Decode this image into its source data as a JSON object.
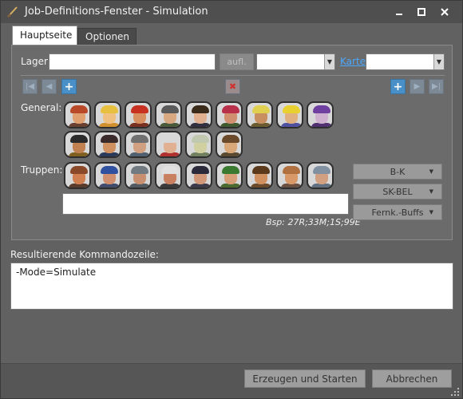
{
  "window": {
    "title": "Job-Definitions-Fenster - Simulation"
  },
  "tabs": [
    {
      "label": "Hauptseite",
      "active": true
    },
    {
      "label": "Optionen",
      "active": false
    }
  ],
  "main": {
    "lager_label": "Lager:",
    "lager_value": "",
    "aufl_button": "aufl.",
    "combo1_value": "",
    "karte_link": "Karte",
    "combo2_value": "",
    "general_label": "General:",
    "truppen_label": "Truppen:",
    "truppen_input_value": "",
    "hint": "Bsp: 27R;33M;1S;99E",
    "dropdown_buttons": [
      "B-K",
      "SK-BEL",
      "Fernk.-Buffs"
    ]
  },
  "result": {
    "label": "Resultierende Kommandozeile:",
    "value": "-Mode=Simulate"
  },
  "buttons": {
    "create": "Erzeugen und Starten",
    "cancel": "Abbrechen"
  },
  "colors": {
    "window_bg": "#616161",
    "panel_bg": "#6b6b6b",
    "accent_blue": "#4a90c8",
    "link": "#4aa8ff",
    "delete_red": "#d03030"
  },
  "generals": [
    {
      "name": "general-1",
      "hat": "#b84a2a",
      "face": "#e0a070",
      "body": "#6a4030"
    },
    {
      "name": "general-2",
      "hat": "#e8c040",
      "face": "#f0c080",
      "body": "#d09030"
    },
    {
      "name": "general-3",
      "hat": "#c83020",
      "face": "#d89060",
      "body": "#7a3020"
    },
    {
      "name": "general-4",
      "hat": "#5a5a5a",
      "face": "#d8a880",
      "body": "#4a5a3a"
    },
    {
      "name": "general-5",
      "hat": "#3a2a1a",
      "face": "#e0b090",
      "body": "#303040"
    },
    {
      "name": "general-6",
      "hat": "#b8304a",
      "face": "#d09070",
      "body": "#405a30"
    },
    {
      "name": "general-7",
      "hat": "#e0d050",
      "face": "#c89060",
      "body": "#6a5a30"
    },
    {
      "name": "general-8",
      "hat": "#e8d030",
      "face": "#e0b080",
      "body": "#5050a0"
    },
    {
      "name": "general-9",
      "hat": "#7040a0",
      "face": "#d0b0d0",
      "body": "#503070"
    },
    {
      "name": "general-10",
      "hat": "#2a2a2a",
      "face": "#c08050",
      "body": "#806020"
    },
    {
      "name": "general-11",
      "hat": "#3a2a2a",
      "face": "#d09060",
      "body": "#2a3a5a"
    },
    {
      "name": "general-12",
      "hat": "#707070",
      "face": "#d0a080",
      "body": "#506070"
    },
    {
      "name": "general-13",
      "hat": "#d8d8d8",
      "face": "#e0b090",
      "body": "#b03030"
    },
    {
      "name": "general-14",
      "hat": "#c0c8b0",
      "face": "#d0d0a0",
      "body": "#708060"
    },
    {
      "name": "general-15",
      "hat": "#6a4a2a",
      "face": "#d8a878",
      "body": "#5a4a30"
    }
  ],
  "troops": [
    {
      "name": "troop-1",
      "hat": "#8a4a2a",
      "face": "#d08050",
      "body": "#5a3a2a"
    },
    {
      "name": "troop-2",
      "hat": "#3050a0",
      "face": "#d09070",
      "body": "#404a6a"
    },
    {
      "name": "troop-3",
      "hat": "#707a80",
      "face": "#c89070",
      "body": "#505a60"
    },
    {
      "name": "troop-4",
      "hat": "#e0e0e0",
      "face": "#c88060",
      "body": "#3a3a3a"
    },
    {
      "name": "troop-5",
      "hat": "#2a2a3a",
      "face": "#d09878",
      "body": "#3a3a4a"
    },
    {
      "name": "troop-6",
      "hat": "#3a7a30",
      "face": "#d8a078",
      "body": "#4a6a30"
    },
    {
      "name": "troop-7",
      "hat": "#5a3a1a",
      "face": "#d09060",
      "body": "#6a4a2a"
    },
    {
      "name": "troop-8",
      "hat": "#b07040",
      "face": "#d89868",
      "body": "#6a5040"
    },
    {
      "name": "troop-9",
      "hat": "#8090a0",
      "face": "#d0a080",
      "body": "#607080"
    }
  ]
}
